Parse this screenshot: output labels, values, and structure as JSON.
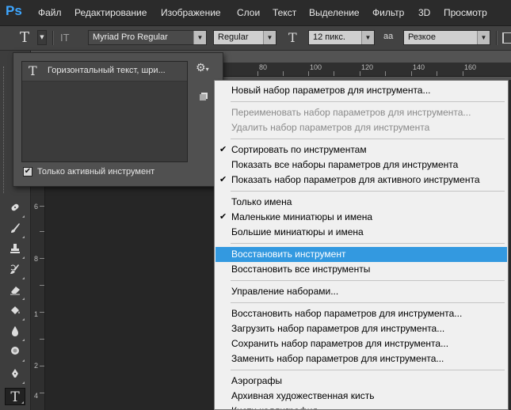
{
  "app": {
    "logo": "Ps"
  },
  "menubar": [
    "Файл",
    "Редактирование",
    "Изображение",
    "Слои",
    "Текст",
    "Выделение",
    "Фильтр",
    "3D",
    "Просмотр"
  ],
  "options": {
    "tool_icon": "T",
    "orient_icon": "IT",
    "font_family": "Myriad Pro Regular",
    "font_style": "Regular",
    "size_icon": "T",
    "font_size": "12 пикс.",
    "aa_icon": "aa",
    "antialias": "Резкое"
  },
  "rulers": {
    "h": [
      "80",
      "100",
      "120",
      "140",
      "160",
      "180",
      "200"
    ],
    "v": [
      "6",
      "8",
      "1",
      "2",
      "4",
      "6"
    ]
  },
  "preset_panel": {
    "item_label": "Горизонтальный текст, шри...",
    "item_icon": "T",
    "checkbox_label": "Только активный инструмент",
    "checked": true
  },
  "context_menu": {
    "items": [
      {
        "label": "Новый набор параметров для инструмента...",
        "state": "normal"
      },
      {
        "sep": true
      },
      {
        "label": "Переименовать набор параметров для инструмента...",
        "state": "disabled"
      },
      {
        "label": "Удалить набор параметров для инструмента",
        "state": "disabled"
      },
      {
        "sep": true
      },
      {
        "label": "Сортировать по инструментам",
        "state": "checked"
      },
      {
        "label": "Показать все наборы параметров для инструмента",
        "state": "normal"
      },
      {
        "label": "Показать набор параметров для активного инструмента",
        "state": "checked"
      },
      {
        "sep": true
      },
      {
        "label": "Только имена",
        "state": "normal"
      },
      {
        "label": "Маленькие миниатюры и имена",
        "state": "checked"
      },
      {
        "label": "Большие миниатюры и имена",
        "state": "normal"
      },
      {
        "sep": true
      },
      {
        "label": "Восстановить инструмент",
        "state": "highlight"
      },
      {
        "label": "Восстановить все инструменты",
        "state": "normal"
      },
      {
        "sep": true
      },
      {
        "label": "Управление наборами...",
        "state": "normal"
      },
      {
        "sep": true
      },
      {
        "label": "Восстановить набор параметров для инструмента...",
        "state": "normal"
      },
      {
        "label": "Загрузить набор параметров для инструмента...",
        "state": "normal"
      },
      {
        "label": "Сохранить набор параметров для инструмента...",
        "state": "normal"
      },
      {
        "label": "Заменить набор параметров для инструмента...",
        "state": "normal"
      },
      {
        "sep": true
      },
      {
        "label": "Аэрографы",
        "state": "normal"
      },
      {
        "label": "Архивная художественная кисть",
        "state": "normal"
      },
      {
        "label": "Кисти каллиграфия",
        "state": "normal"
      }
    ],
    "checkmark": "✔"
  },
  "tools": [
    "healing-brush-icon",
    "brush-icon",
    "stamp-icon",
    "history-brush-icon",
    "eraser-icon",
    "paint-bucket-icon",
    "blur-icon",
    "dodge-icon",
    "pen-icon",
    "type-tool-icon"
  ],
  "colors": {
    "highlight": "#3399e0",
    "menubar": "#2b2b2b",
    "logo": "#3ea6ff"
  }
}
